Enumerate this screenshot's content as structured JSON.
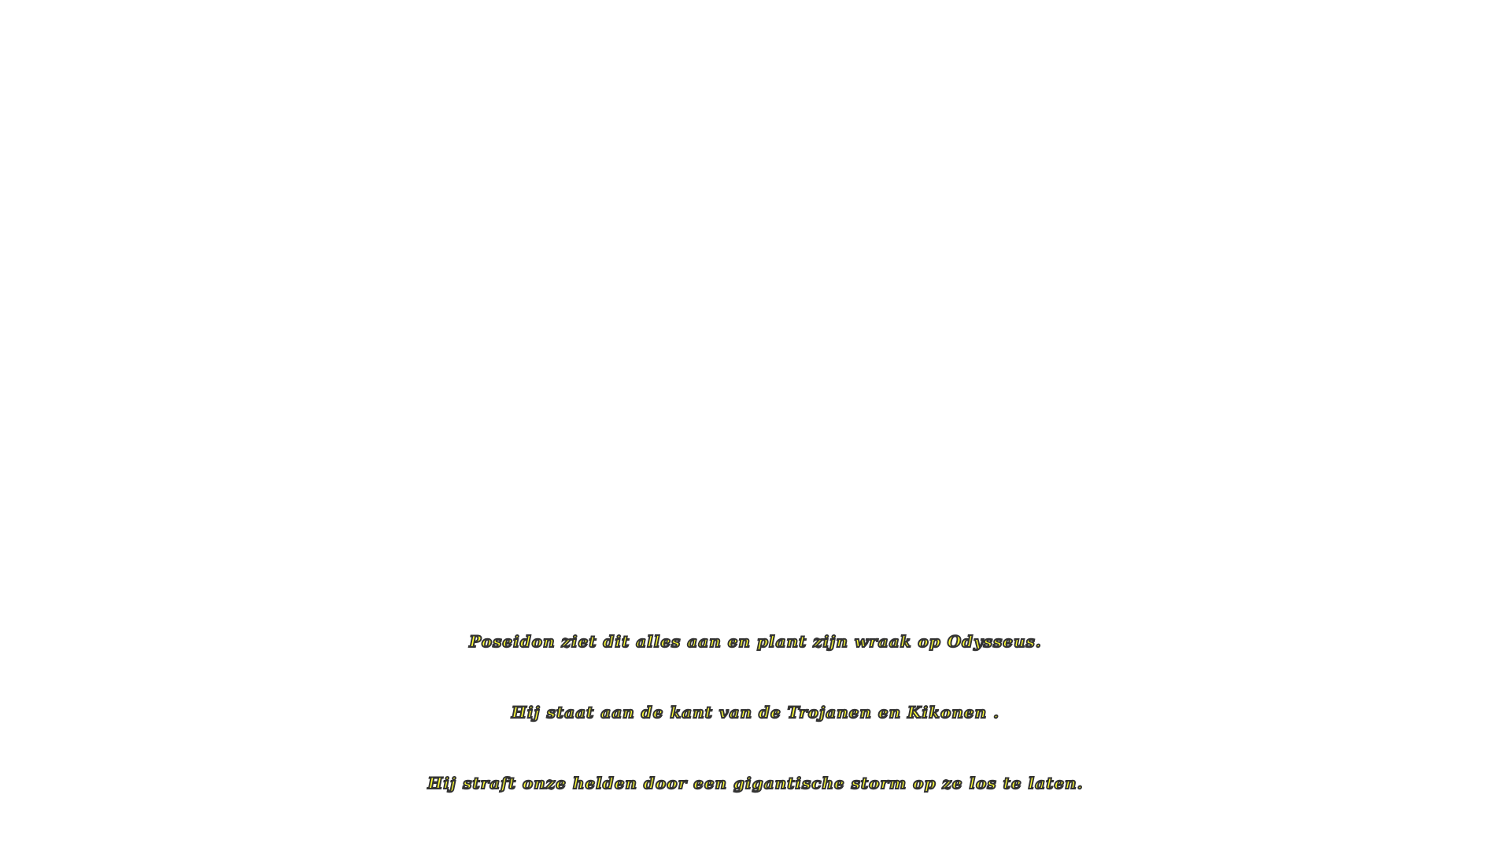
{
  "subtitle": {
    "lines": [
      "Poseidon ziet dit alles aan en plant zijn wraak op Odysseus.",
      "Hij staat aan de kant van de Trojanen en Kikonen .",
      "Hij straft onze helden door een gigantische storm op ze los te laten."
    ]
  },
  "colors": {
    "background": "#ffffff",
    "text_fill": "#ffff33",
    "text_outline": "#333333"
  }
}
